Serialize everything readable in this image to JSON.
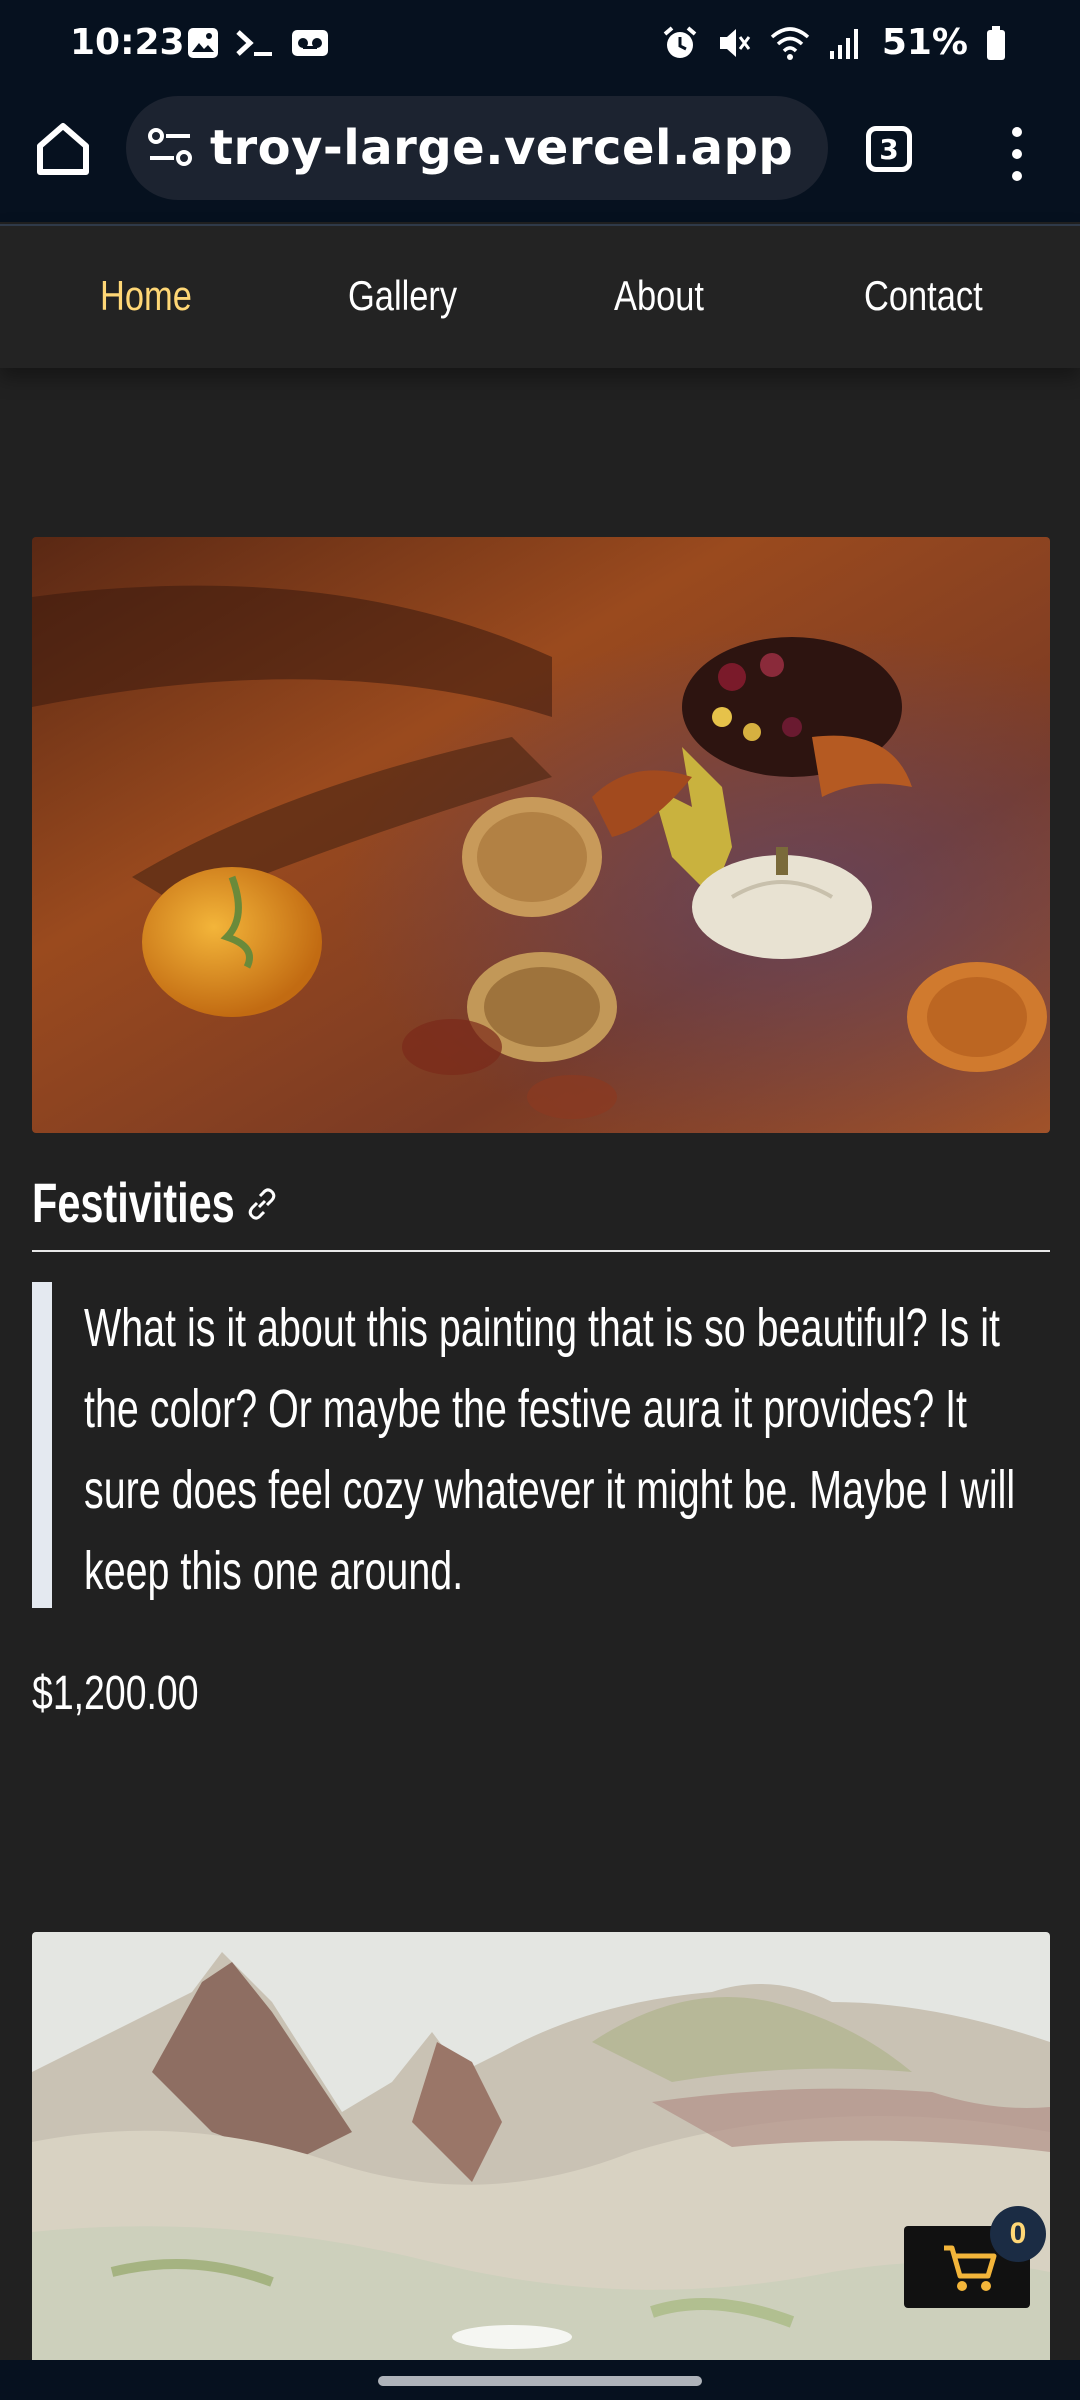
{
  "status_bar": {
    "time": "10:23",
    "battery": "51%",
    "left_icons": [
      "image-icon",
      "terminal-icon",
      "voicemail-icon"
    ],
    "right_icons": [
      "alarm-icon",
      "mute-icon",
      "wifi-icon",
      "signal-icon",
      "battery-icon"
    ]
  },
  "browser": {
    "url": "troy-large.vercel.app",
    "tab_count": "3"
  },
  "nav": {
    "items": [
      {
        "label": "Home",
        "active": true
      },
      {
        "label": "Gallery",
        "active": false
      },
      {
        "label": "About",
        "active": false
      },
      {
        "label": "Contact",
        "active": false
      }
    ]
  },
  "listing": {
    "title": "Festivities",
    "description": "What is it about this painting that is so beautiful? Is it the color? Or maybe the festive aura it provides? It sure does feel cozy whatever it might be. Maybe I will keep this one around.",
    "price": "$1,200.00"
  },
  "cart": {
    "count": "0"
  },
  "colors": {
    "accent": "#ffd776",
    "background": "#212121",
    "browser_chrome": "#06111f"
  }
}
